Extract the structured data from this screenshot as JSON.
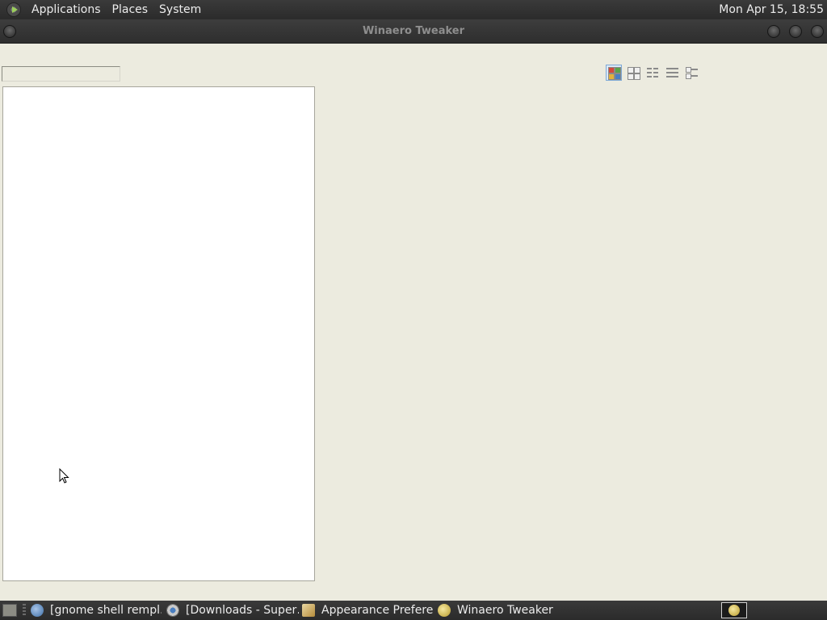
{
  "top_panel": {
    "menus": [
      "Applications",
      "Places",
      "System"
    ],
    "clock": "Mon Apr 15, 18:55"
  },
  "window": {
    "title": "Winaero Tweaker"
  },
  "search": {
    "value": "",
    "placeholder": ""
  },
  "view_modes": [
    "thumbnails",
    "icons",
    "list",
    "details",
    "tiles"
  ],
  "taskbar": {
    "tasks": [
      {
        "label": "[gnome shell rempl…",
        "icon": "globe-icon"
      },
      {
        "label": "[Downloads - Super…",
        "icon": "chromium-icon"
      },
      {
        "label": "Appearance Prefere…",
        "icon": "appearance-icon"
      },
      {
        "label": "Winaero Tweaker",
        "icon": "winaero-icon"
      }
    ]
  },
  "colors": {
    "panel_bg": "#2e2e2e",
    "window_bg": "#ecebdf",
    "tree_bg": "#ffffff",
    "accent": "#7ea9d6"
  }
}
